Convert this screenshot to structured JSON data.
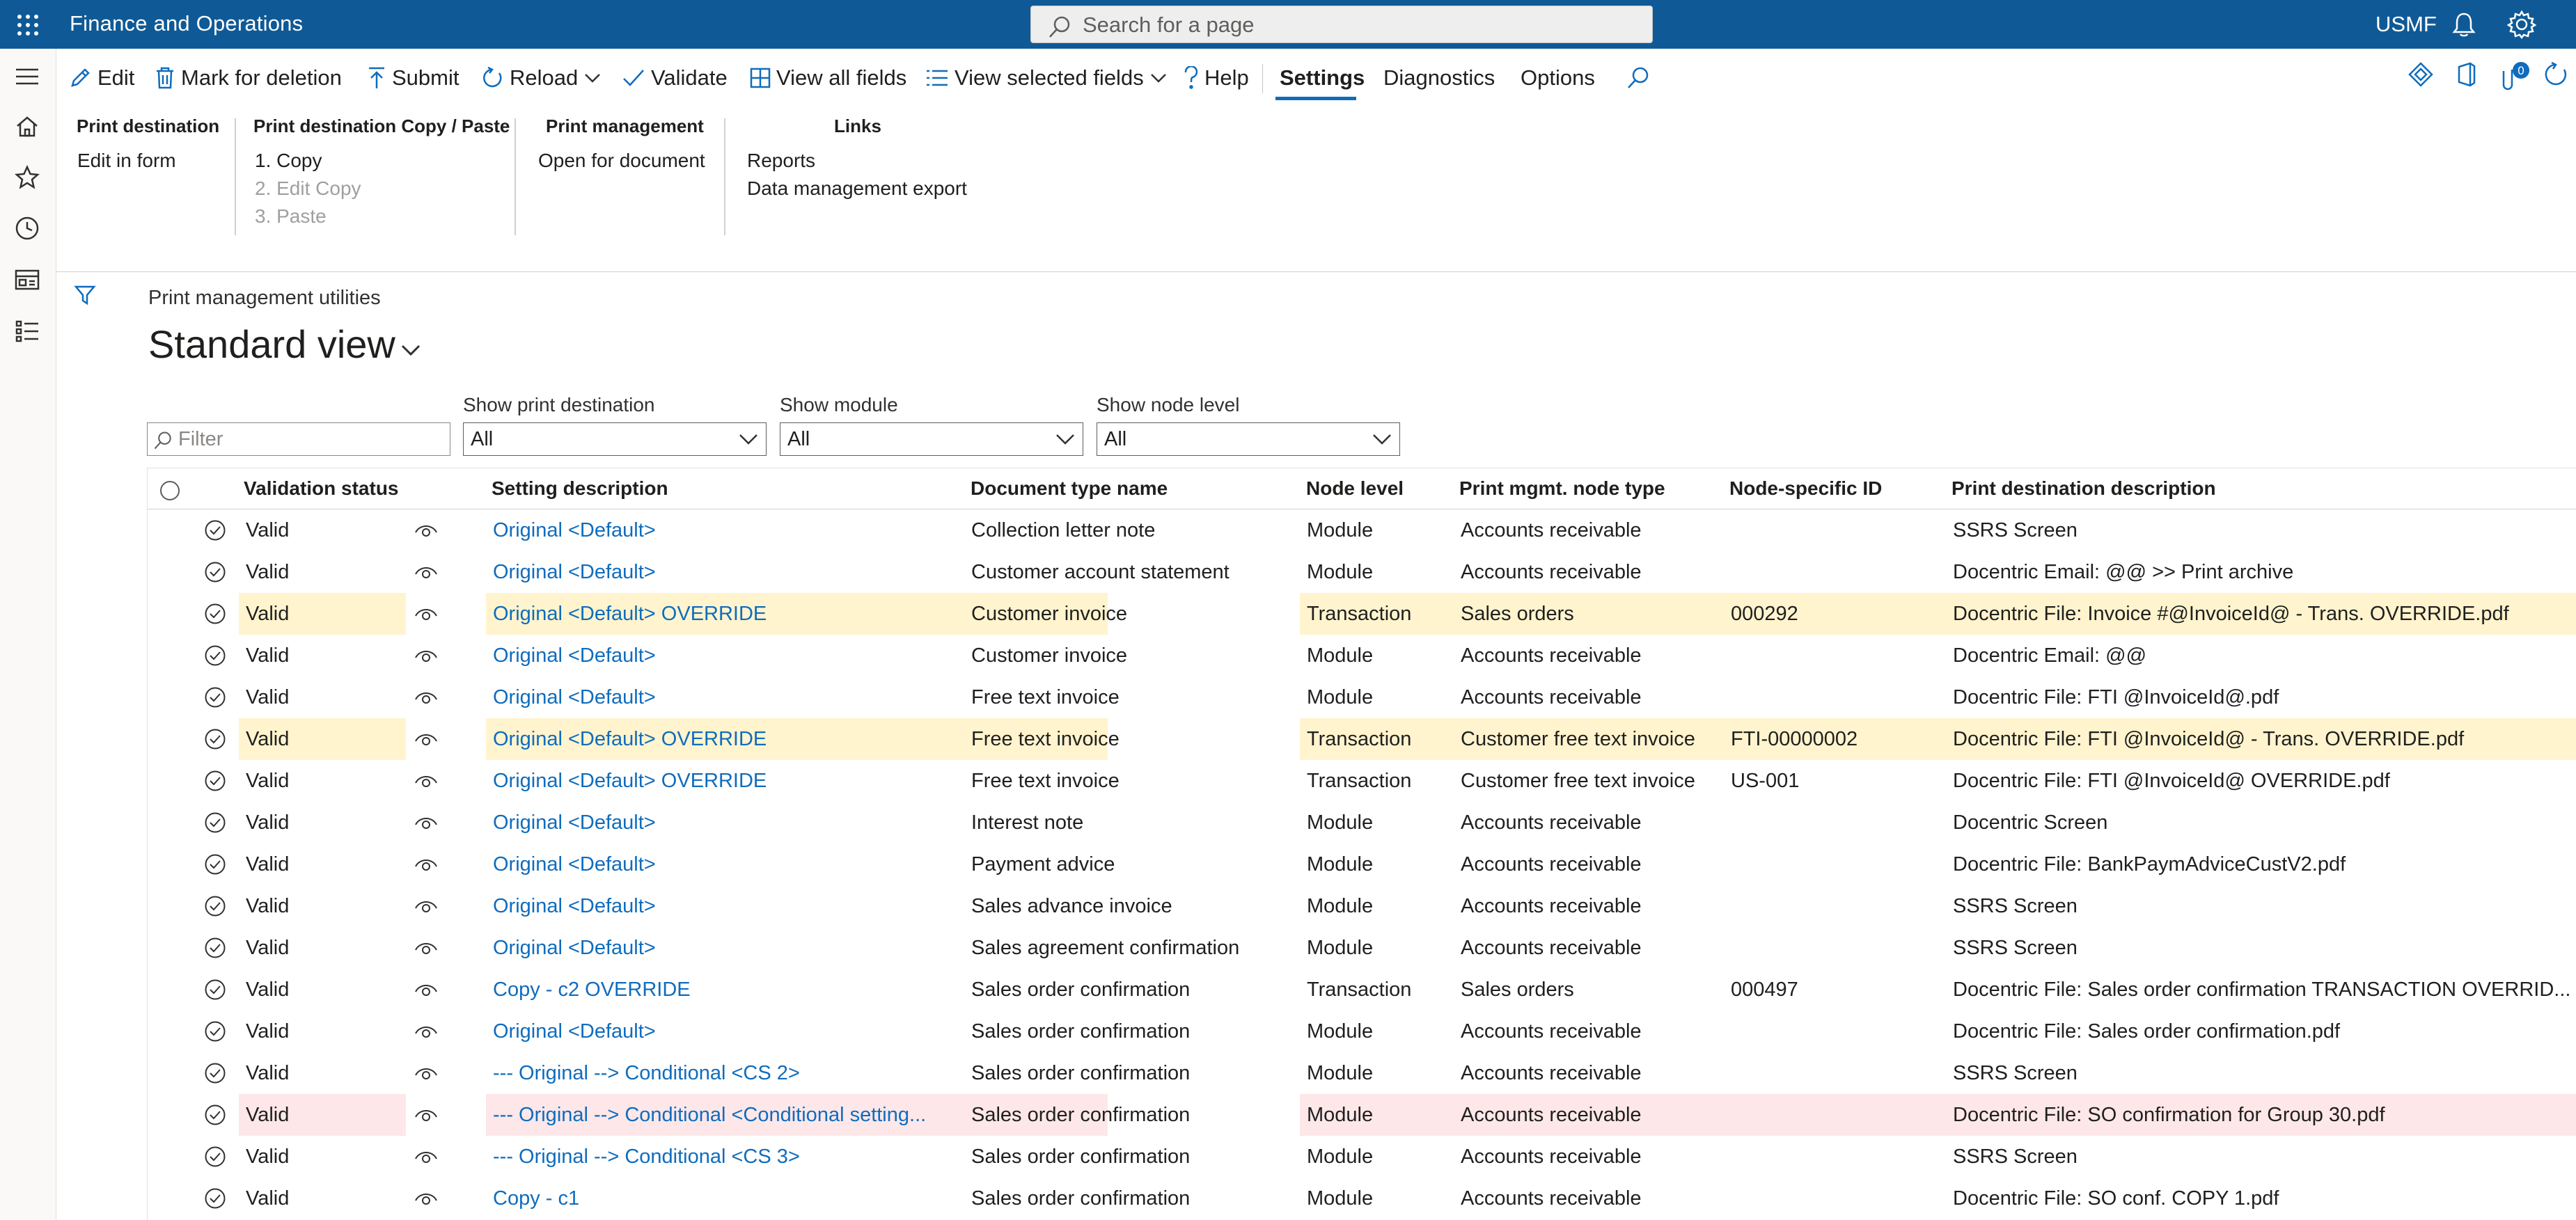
{
  "app": {
    "title": "Finance and Operations",
    "company": "USMF"
  },
  "search": {
    "placeholder": "Search for a page"
  },
  "notifications": {
    "count": "0"
  },
  "actions": {
    "edit": "Edit",
    "mark_deletion": "Mark for deletion",
    "submit": "Submit",
    "reload": "Reload",
    "validate": "Validate",
    "view_all_fields": "View all fields",
    "view_selected_fields": "View selected fields",
    "help": "Help",
    "settings": "Settings",
    "diagnostics": "Diagnostics",
    "options": "Options"
  },
  "ribbon": {
    "print_destination": {
      "title": "Print destination",
      "items": [
        "Edit in form"
      ]
    },
    "copy_paste": {
      "title": "Print destination Copy / Paste",
      "items": [
        "1. Copy",
        "2. Edit Copy",
        "3. Paste"
      ]
    },
    "print_management": {
      "title": "Print management",
      "items": [
        "Open for document"
      ]
    },
    "links": {
      "title": "Links",
      "items": [
        "Reports",
        "Data management export"
      ]
    }
  },
  "page": {
    "caption": "Print management utilities",
    "view": "Standard view"
  },
  "filters": {
    "filter_placeholder": "Filter",
    "show_print_destination": {
      "label": "Show print destination",
      "value": "All"
    },
    "show_module": {
      "label": "Show module",
      "value": "All"
    },
    "show_node_level": {
      "label": "Show node level",
      "value": "All"
    }
  },
  "grid": {
    "columns": {
      "validation_status": "Validation status",
      "setting_description": "Setting description",
      "document_type_name": "Document type name",
      "node_level": "Node level",
      "node_type": "Print mgmt. node type",
      "node_id": "Node-specific ID",
      "destination": "Print destination description"
    },
    "rows": [
      {
        "status": "Valid",
        "desc": "Original <Default>",
        "doc": "Collection letter note",
        "level": "Module",
        "type": "Accounts receivable",
        "id": "",
        "dest": "SSRS Screen",
        "highlight": ""
      },
      {
        "status": "Valid",
        "desc": "Original <Default>",
        "doc": "Customer account statement",
        "level": "Module",
        "type": "Accounts receivable",
        "id": "",
        "dest": "Docentric Email: @@ >> Print archive",
        "highlight": ""
      },
      {
        "status": "Valid",
        "desc": "Original <Default> OVERRIDE",
        "doc": "Customer invoice",
        "level": "Transaction",
        "type": "Sales orders",
        "id": "000292",
        "dest": "Docentric File: Invoice #@InvoiceId@ - Trans. OVERRIDE.pdf",
        "highlight": "yellow"
      },
      {
        "status": "Valid",
        "desc": "Original <Default>",
        "doc": "Customer invoice",
        "level": "Module",
        "type": "Accounts receivable",
        "id": "",
        "dest": "Docentric Email: @@",
        "highlight": ""
      },
      {
        "status": "Valid",
        "desc": "Original <Default>",
        "doc": "Free text invoice",
        "level": "Module",
        "type": "Accounts receivable",
        "id": "",
        "dest": "Docentric File: FTI @InvoiceId@.pdf",
        "highlight": ""
      },
      {
        "status": "Valid",
        "desc": "Original <Default> OVERRIDE",
        "doc": "Free text invoice",
        "level": "Transaction",
        "type": "Customer free text invoice",
        "id": "FTI-00000002",
        "dest": "Docentric File: FTI @InvoiceId@ - Trans. OVERRIDE.pdf",
        "highlight": "yellow"
      },
      {
        "status": "Valid",
        "desc": "Original <Default> OVERRIDE",
        "doc": "Free text invoice",
        "level": "Transaction",
        "type": "Customer free text invoice",
        "id": "US-001",
        "dest": "Docentric File: FTI @InvoiceId@ OVERRIDE.pdf",
        "highlight": ""
      },
      {
        "status": "Valid",
        "desc": "Original <Default>",
        "doc": "Interest note",
        "level": "Module",
        "type": "Accounts receivable",
        "id": "",
        "dest": "Docentric Screen",
        "highlight": ""
      },
      {
        "status": "Valid",
        "desc": "Original <Default>",
        "doc": "Payment advice",
        "level": "Module",
        "type": "Accounts receivable",
        "id": "",
        "dest": "Docentric File: BankPaymAdviceCustV2.pdf",
        "highlight": ""
      },
      {
        "status": "Valid",
        "desc": "Original <Default>",
        "doc": "Sales advance invoice",
        "level": "Module",
        "type": "Accounts receivable",
        "id": "",
        "dest": "SSRS Screen",
        "highlight": ""
      },
      {
        "status": "Valid",
        "desc": "Original <Default>",
        "doc": "Sales agreement confirmation",
        "level": "Module",
        "type": "Accounts receivable",
        "id": "",
        "dest": "SSRS Screen",
        "highlight": ""
      },
      {
        "status": "Valid",
        "desc": "Copy - c2 OVERRIDE",
        "doc": "Sales order confirmation",
        "level": "Transaction",
        "type": "Sales orders",
        "id": "000497",
        "dest": "Docentric File: Sales order confirmation TRANSACTION OVERRID...",
        "highlight": ""
      },
      {
        "status": "Valid",
        "desc": "Original <Default>",
        "doc": "Sales order confirmation",
        "level": "Module",
        "type": "Accounts receivable",
        "id": "",
        "dest": "Docentric File: Sales order confirmation.pdf",
        "highlight": ""
      },
      {
        "status": "Valid",
        "desc": "--- Original --> Conditional <CS 2>",
        "doc": "Sales order confirmation",
        "level": "Module",
        "type": "Accounts receivable",
        "id": "",
        "dest": "SSRS Screen",
        "highlight": ""
      },
      {
        "status": "Valid",
        "desc": "--- Original --> Conditional <Conditional setting...",
        "doc": "Sales order confirmation",
        "level": "Module",
        "type": "Accounts receivable",
        "id": "",
        "dest": "Docentric File: SO confirmation for Group 30.pdf",
        "highlight": "red"
      },
      {
        "status": "Valid",
        "desc": "--- Original --> Conditional <CS 3>",
        "doc": "Sales order confirmation",
        "level": "Module",
        "type": "Accounts receivable",
        "id": "",
        "dest": "SSRS Screen",
        "highlight": ""
      },
      {
        "status": "Valid",
        "desc": "Copy - c1",
        "doc": "Sales order confirmation",
        "level": "Module",
        "type": "Accounts receivable",
        "id": "",
        "dest": "Docentric File: SO conf. COPY 1.pdf",
        "highlight": ""
      }
    ]
  }
}
